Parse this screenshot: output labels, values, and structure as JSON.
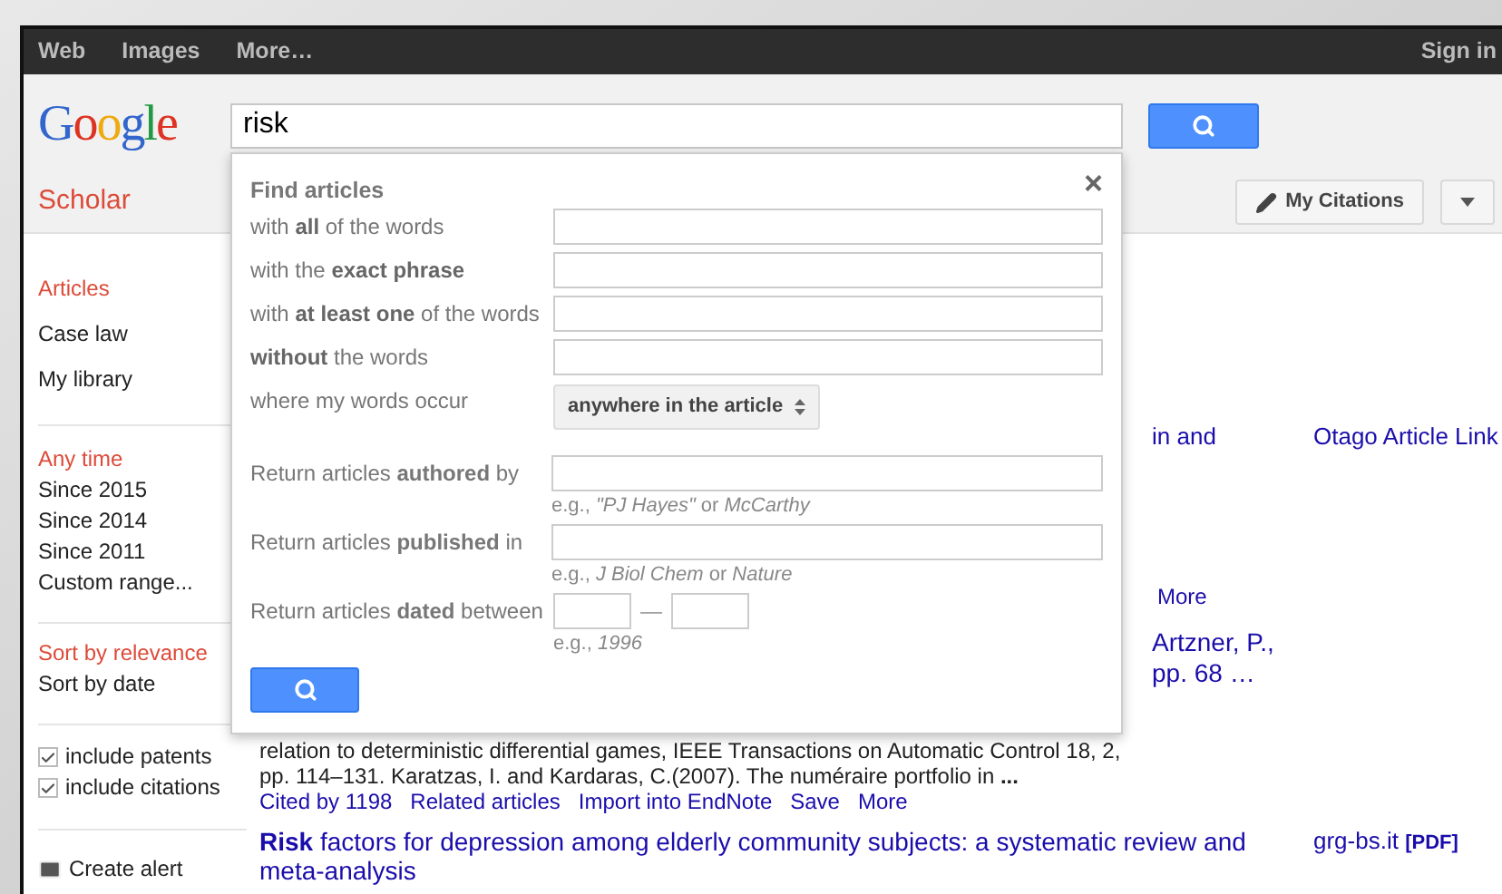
{
  "top_nav": {
    "links": [
      "Web",
      "Images",
      "More…"
    ],
    "sign_in": "Sign in"
  },
  "header": {
    "logo": "Google",
    "search": {
      "value": "risk"
    },
    "section_title": "Scholar",
    "my_citations": "My Citations"
  },
  "sidebar": {
    "groups": [
      {
        "items": [
          {
            "label": "Articles",
            "selected": true
          },
          {
            "label": "Case law",
            "selected": false
          },
          {
            "label": "My library",
            "selected": false
          }
        ]
      },
      {
        "items": [
          {
            "label": "Any time",
            "selected": true
          },
          {
            "label": "Since 2015",
            "selected": false
          },
          {
            "label": "Since 2014",
            "selected": false
          },
          {
            "label": "Since 2011",
            "selected": false
          },
          {
            "label": "Custom range...",
            "selected": false
          }
        ]
      },
      {
        "items": [
          {
            "label": "Sort by relevance",
            "selected": true
          },
          {
            "label": "Sort by date",
            "selected": false
          }
        ]
      }
    ],
    "checkboxes": [
      {
        "label": "include patents",
        "checked": true
      },
      {
        "label": "include citations",
        "checked": true
      }
    ],
    "create_alert": "Create alert"
  },
  "results": [
    {
      "kind": "title_tail",
      "title": "in and",
      "source": "Otago Article Link"
    },
    {
      "kind": "links",
      "links": [
        "More"
      ]
    },
    {
      "kind": "title_lines",
      "lines": [
        "Artzner, P.,",
        "pp. 68 …"
      ]
    },
    {
      "kind": "snippet",
      "lines": [
        "relation to deterministic differential games, IEEE Transactions on Automatic Control 18, 2,",
        "pp. 114–131. Karatzas, I. and Kardaras, C.(2007). The numéraire portfolio in **...**"
      ],
      "links": [
        "Cited by 1198",
        "Related articles",
        "Import into EndNote",
        "Save",
        "More"
      ]
    },
    {
      "kind": "title",
      "title": "**Risk** factors for depression among elderly community subjects: a systematic review and meta-analysis",
      "source": "grg-bs.it",
      "format": "[PDF]"
    }
  ],
  "advanced_search": {
    "title": "Find articles",
    "close": "×",
    "rows": [
      {
        "kind": "text",
        "label": "with **all** of the words"
      },
      {
        "kind": "text",
        "label": "with the **exact phrase**"
      },
      {
        "kind": "text",
        "label": "with **at least one** of the words"
      },
      {
        "kind": "text",
        "label": "**without** the words"
      },
      {
        "kind": "select",
        "label": "where my words occur",
        "value": "anywhere in the article"
      }
    ],
    "return_rows": [
      {
        "kind": "text",
        "label": "Return articles **authored** by",
        "hint": "e.g., *\"PJ Hayes\"* or *McCarthy*"
      },
      {
        "kind": "text",
        "label": "Return articles **published** in",
        "hint": "e.g., *J Biol Chem* or *Nature*"
      },
      {
        "kind": "range",
        "label": "Return articles **dated** between",
        "separator": "—",
        "hint": "e.g., *1996*"
      }
    ]
  }
}
